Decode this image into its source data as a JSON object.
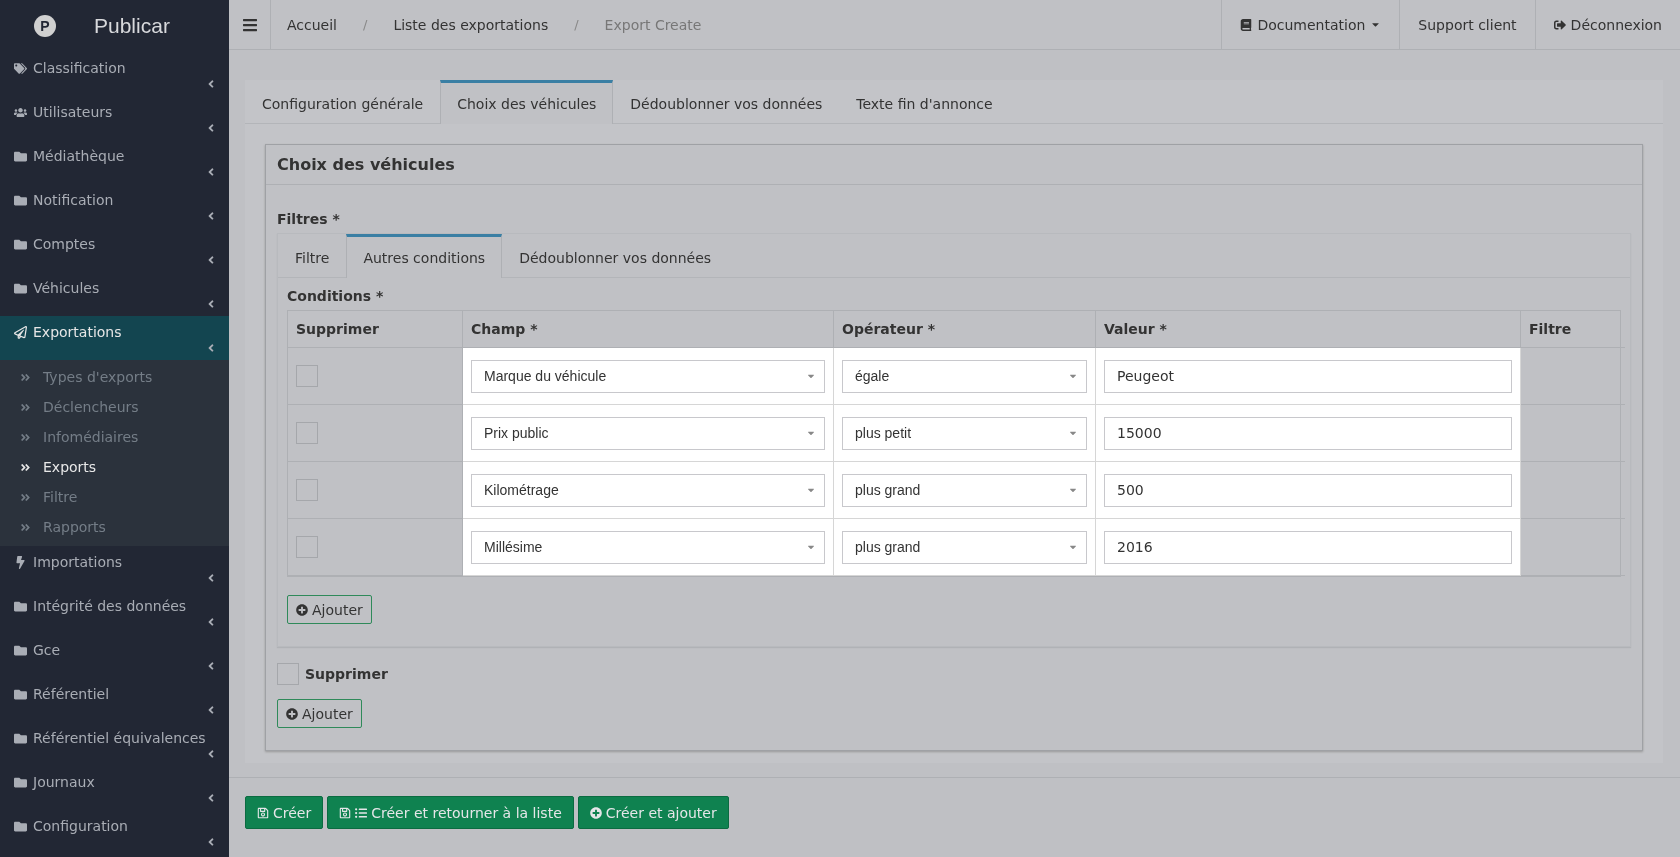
{
  "sidebar": {
    "logo": "P",
    "brand": "Publicar",
    "items": [
      {
        "label": "Classification",
        "expanded": false
      },
      {
        "label": "Utilisateurs",
        "expanded": false
      },
      {
        "label": "Médiathèque",
        "expanded": false
      },
      {
        "label": "Notification",
        "expanded": false
      },
      {
        "label": "Comptes",
        "expanded": false
      },
      {
        "label": "Véhicules",
        "expanded": false
      },
      {
        "label": "Exportations",
        "expanded": true,
        "children": [
          {
            "label": "Types d'exports",
            "selected": false
          },
          {
            "label": "Déclencheurs",
            "selected": false
          },
          {
            "label": "Infomédiaires",
            "selected": false
          },
          {
            "label": "Exports",
            "selected": true
          },
          {
            "label": "Filtre",
            "selected": false
          },
          {
            "label": "Rapports",
            "selected": false
          }
        ]
      },
      {
        "label": "Importations",
        "expanded": false
      },
      {
        "label": "Intégrité des données",
        "expanded": false
      },
      {
        "label": "Gce",
        "expanded": false
      },
      {
        "label": "Référentiel",
        "expanded": false
      },
      {
        "label": "Référentiel équivalences",
        "expanded": false
      },
      {
        "label": "Journaux",
        "expanded": false
      },
      {
        "label": "Configuration",
        "expanded": false
      }
    ]
  },
  "breadcrumbs": [
    {
      "label": "Accueil",
      "current": false
    },
    {
      "separator": "/",
      "label": "Liste des exportations",
      "current": false
    },
    {
      "separator": "/",
      "label": "Export Create",
      "current": true
    }
  ],
  "top_links": [
    {
      "label": "Documentation",
      "kind": "dropdown"
    },
    {
      "label": "Support client",
      "kind": "plain"
    },
    {
      "label": "Déconnexion",
      "kind": "logout"
    }
  ],
  "tabs": [
    {
      "label": "Configuration générale",
      "selected": false
    },
    {
      "label": "Choix des véhicules",
      "selected": true
    },
    {
      "label": "Dédoublonner vos données",
      "selected": false
    },
    {
      "label": "Texte fin d'annonce",
      "selected": false
    }
  ],
  "panel": {
    "title": "Choix des véhicules",
    "filters_label": "Filtres *",
    "subtabs": [
      {
        "label": "Filtre",
        "selected": false
      },
      {
        "label": "Autres conditions",
        "selected": true
      },
      {
        "label": "Dédoublonner vos données",
        "selected": false
      }
    ],
    "conditions_label": "Conditions *",
    "columns": [
      "Supprimer",
      "Champ *",
      "Opérateur *",
      "Valeur *",
      "Filtre"
    ],
    "rows": [
      {
        "checked": false,
        "field": "Marque du véhicule",
        "operator": "égale",
        "value": "Peugeot"
      },
      {
        "checked": false,
        "field": "Prix public",
        "operator": "plus petit",
        "value": "15000"
      },
      {
        "checked": false,
        "field": "Kilométrage",
        "operator": "plus grand",
        "value": "500"
      },
      {
        "checked": false,
        "field": "Millésime",
        "operator": "plus grand",
        "value": "2016"
      }
    ],
    "inner_add": "Ajouter",
    "delete": {
      "label": "Supprimer",
      "checked": false
    },
    "outer_add": "Ajouter"
  },
  "footer_buttons": [
    "Créer",
    "Créer et retourner à la liste",
    "Créer et ajouter"
  ]
}
